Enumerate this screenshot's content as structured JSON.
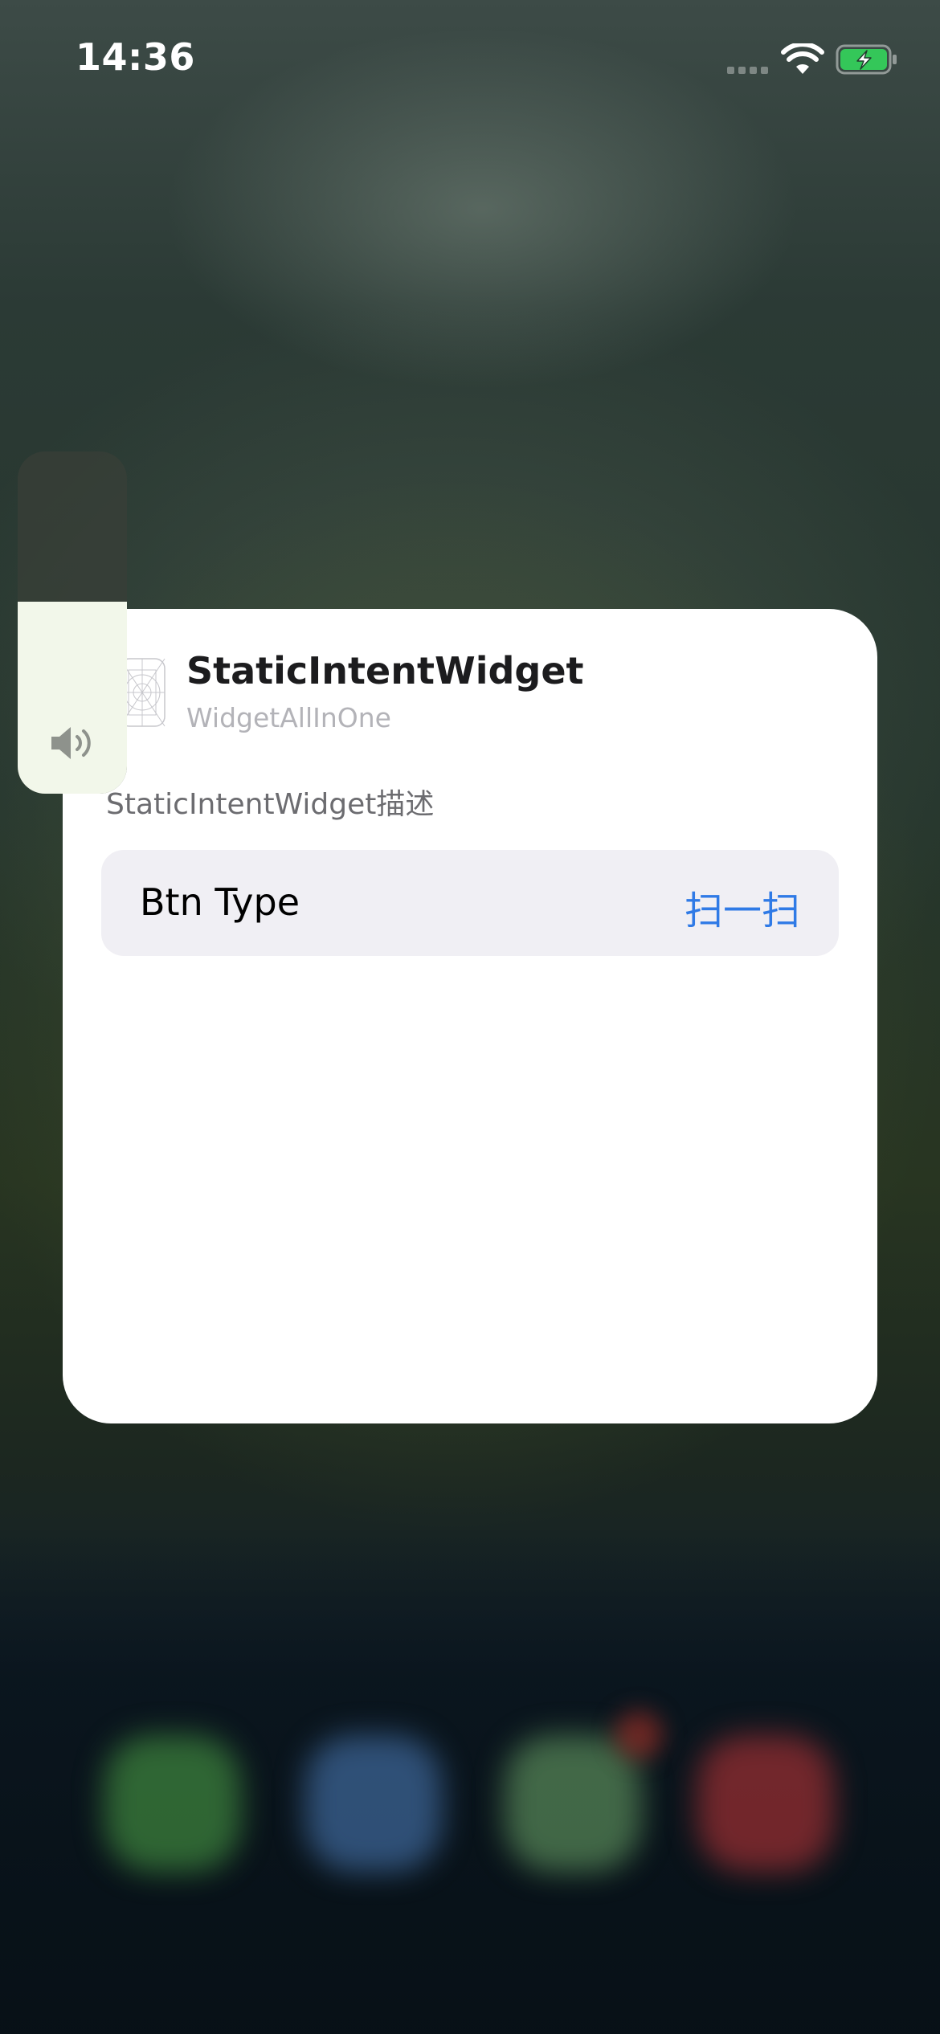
{
  "status_bar": {
    "time": "14:36",
    "icons": [
      "cellular-signal-icon",
      "wifi-icon",
      "battery-charging-icon"
    ]
  },
  "volume": {
    "level": 0.56,
    "icon": "speaker-icon"
  },
  "widget_card": {
    "title": "StaticIntentWidget",
    "subtitle": "WidgetAllInOne",
    "description": "StaticIntentWidget描述",
    "parameter": {
      "label": "Btn Type",
      "value": "扫一扫"
    }
  },
  "colors": {
    "accent": "#2f7ae6",
    "battery": "#34c759",
    "card_background": "#ffffff",
    "row_background": "#f0eff4"
  }
}
